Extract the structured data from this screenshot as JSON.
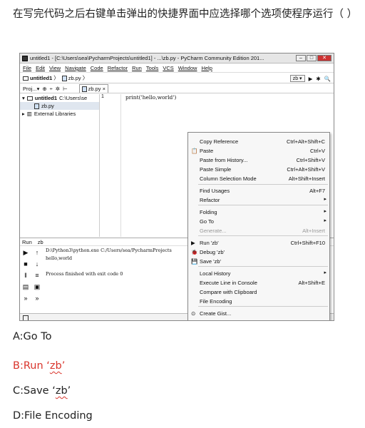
{
  "question": "在写完代码之后右键单击弹出的快捷界面中应选择哪个选项使程序运行（  ）",
  "ide": {
    "title": "untitled1 - [C:\\Users\\sea\\PycharmProjects\\untitled1] - ...\\zb.py - PyCharm Community Edition 201...",
    "window_buttons": [
      "–",
      "□",
      "✕"
    ],
    "menu": [
      "File",
      "Edit",
      "View",
      "Navigate",
      "Code",
      "Refactor",
      "Run",
      "Tools",
      "VCS",
      "Window",
      "Help"
    ],
    "nav": {
      "project": "untitled1",
      "file": "zb.py",
      "run_config": "zb ▾"
    },
    "toolbar": {
      "project_tab": "Proj...▾",
      "editor_tab": "zb.py ×"
    },
    "tree": {
      "root": "untitled1",
      "root_path": "C:\\Users\\se",
      "file": "zb.py",
      "libs": "External Libraries"
    },
    "gutter_line": "1",
    "code": "print('hello,world')",
    "run_panel": {
      "label": "Run",
      "config": "zb",
      "console_lines": [
        "D:\\Python3\\python.exe C:/Users/sea/PycharmProjects",
        "hello,world",
        "",
        "Process finished with exit code 0"
      ]
    },
    "context_menu": {
      "items": [
        {
          "label": "Copy Reference",
          "shortcut": "Ctrl+Alt+Shift+C",
          "icon": "",
          "arrow": ""
        },
        {
          "label": "Paste",
          "shortcut": "Ctrl+V",
          "icon": "📋",
          "arrow": ""
        },
        {
          "label": "Paste from History...",
          "shortcut": "Ctrl+Shift+V",
          "icon": "",
          "arrow": ""
        },
        {
          "label": "Paste Simple",
          "shortcut": "Ctrl+Alt+Shift+V",
          "icon": "",
          "arrow": ""
        },
        {
          "label": "Column Selection Mode",
          "shortcut": "Alt+Shift+Insert",
          "icon": "",
          "arrow": ""
        },
        {
          "label": "Find Usages",
          "shortcut": "Alt+F7",
          "icon": "",
          "arrow": ""
        },
        {
          "label": "Refactor",
          "shortcut": "",
          "icon": "",
          "arrow": "▸"
        },
        {
          "label": "Folding",
          "shortcut": "",
          "icon": "",
          "arrow": "▸"
        },
        {
          "label": "Go To",
          "shortcut": "",
          "icon": "",
          "arrow": "▸"
        },
        {
          "label": "Generate...",
          "shortcut": "Alt+Insert",
          "icon": "",
          "arrow": ""
        },
        {
          "label": "Run 'zb'",
          "shortcut": "Ctrl+Shift+F10",
          "icon": "▶",
          "arrow": ""
        },
        {
          "label": "Debug 'zb'",
          "shortcut": "",
          "icon": "🐞",
          "arrow": ""
        },
        {
          "label": "Save 'zb'",
          "shortcut": "",
          "icon": "💾",
          "arrow": ""
        },
        {
          "label": "Local History",
          "shortcut": "",
          "icon": "",
          "arrow": "▸"
        },
        {
          "label": "Execute Line in Console",
          "shortcut": "Alt+Shift+E",
          "icon": "",
          "arrow": ""
        },
        {
          "label": "Compare with Clipboard",
          "shortcut": "",
          "icon": "",
          "arrow": ""
        },
        {
          "label": "File Encoding",
          "shortcut": "",
          "icon": "",
          "arrow": ""
        },
        {
          "label": "Create Gist...",
          "shortcut": "",
          "icon": "⊙",
          "arrow": ""
        }
      ]
    }
  },
  "options": [
    {
      "text": "A:Go To"
    },
    {
      "prefix": "B:Run ‘",
      "mark": "zb",
      "suffix": "’"
    },
    {
      "prefix": "C:Save ‘",
      "mark": "zb",
      "suffix": "’"
    },
    {
      "text": "D:File Encoding"
    }
  ],
  "colors": {
    "correct": "#d9342b"
  }
}
